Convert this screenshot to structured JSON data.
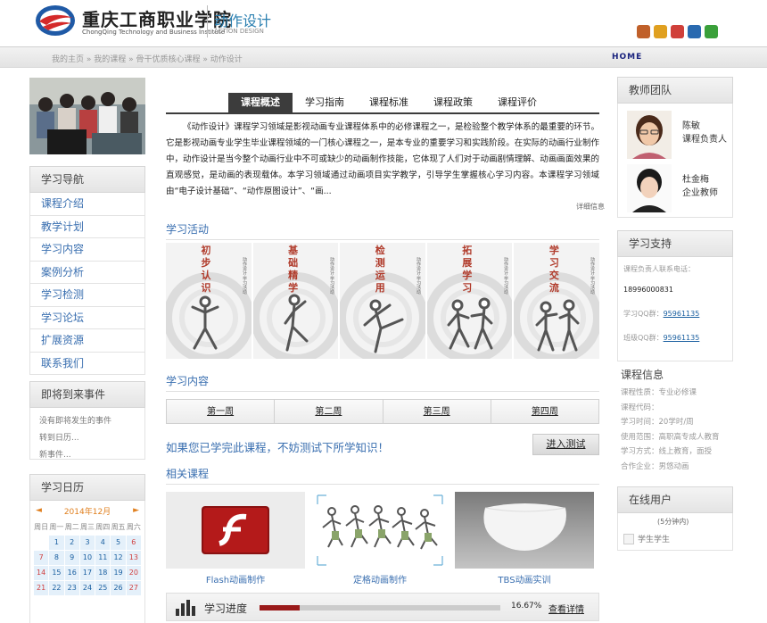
{
  "header": {
    "school_cn": "重庆工商职业学院",
    "school_en": "ChongQing Technology and Business Institute",
    "course_cn": "动作设计",
    "course_en": "ACTION DESIGN"
  },
  "breadcrumb": {
    "items": [
      "我的主页",
      "我的课程",
      "骨干优质核心课程",
      "动作设计"
    ],
    "home_label": "HOME"
  },
  "nav": {
    "title": "学习导航",
    "items": [
      "课程介绍",
      "教学计划",
      "学习内容",
      "案例分析",
      "学习检测",
      "学习论坛",
      "扩展资源",
      "联系我们"
    ]
  },
  "events": {
    "title": "即将到来事件",
    "lines": [
      "没有即将发生的事件",
      "转到日历...",
      "新事件..."
    ]
  },
  "calendar": {
    "title": "学习日历",
    "month": "2014年12月",
    "weekdays": [
      "周日",
      "周一",
      "周二",
      "周三",
      "周四",
      "周五",
      "周六"
    ],
    "rows": [
      [
        "",
        "1",
        "2",
        "3",
        "4",
        "5",
        "6"
      ],
      [
        "7",
        "8",
        "9",
        "10",
        "11",
        "12",
        "13"
      ],
      [
        "14",
        "15",
        "16",
        "17",
        "18",
        "19",
        "20"
      ],
      [
        "21",
        "22",
        "23",
        "24",
        "25",
        "26",
        "27"
      ]
    ]
  },
  "tabs": [
    "课程概述",
    "学习指南",
    "课程标准",
    "课程政策",
    "课程评价"
  ],
  "intro": {
    "text": "《动作设计》课程学习领域是影视动画专业课程体系中的必修课程之一，是检验整个教学体系的最重要的环节。它是影视动画专业学生毕业课程领域的一门核心课程之一，是本专业的重要学习和实践阶段。在实际的动画行业制作中，动作设计是当今整个动画行业中不可或缺少的动画制作技能，它体现了人们对于动画剧情理解、动画画面效果的直观感觉，是动画的表现载体。本学习领域通过动画项目实学教学，引导学生掌握核心学习内容。本课程学习领域由“电子设计基础”、“动作原图设计”、“画...",
    "more": "详细信息"
  },
  "activities": {
    "title": "学习活动",
    "items": [
      {
        "title": "初步认识",
        "side": "动作设计·学习活动"
      },
      {
        "title": "基础精学",
        "side": "动作设计·学习活动"
      },
      {
        "title": "检测运用",
        "side": "动作设计·学习活动"
      },
      {
        "title": "拓展学习",
        "side": "动作设计·学习活动"
      },
      {
        "title": "学习交流",
        "side": "动作设计·学习活动"
      }
    ]
  },
  "content": {
    "title": "学习内容",
    "weeks": [
      "第一周",
      "第二周",
      "第三周",
      "第四周"
    ]
  },
  "test": {
    "question": "如果您已学完此课程，不妨测试下所学知识！",
    "button": "进入测试"
  },
  "related": {
    "title": "相关课程",
    "items": [
      "Flash动画制作",
      "定格动画制作",
      "TBS动画实训"
    ]
  },
  "progress": {
    "label": "学习进度",
    "percent_text": "16.67%",
    "value": 0.1667,
    "link": "查看详情"
  },
  "team": {
    "title": "教师团队",
    "members": [
      {
        "name": "陈敏",
        "role": "课程负责人"
      },
      {
        "name": "杜金梅",
        "role": "企业教师"
      }
    ]
  },
  "support": {
    "title": "学习支持",
    "contact_label": "课程负责人联系电话：",
    "phone": "18996000831",
    "qq1_label": "学习QQ群：",
    "qq1": "95961135",
    "qq2_label": "班级QQ群：",
    "qq2": "95961135"
  },
  "info": {
    "title": "课程信息",
    "lines": [
      "课程性质：专业必修课",
      "课程代码：",
      "学习时间：20学时/周",
      "使用范围：高职高专成人教育",
      "学习方式：线上教育，面授",
      "合作企业：男悠动画"
    ]
  },
  "online": {
    "title": "在线用户",
    "count": "(5分钟内)",
    "user": "学生学生"
  },
  "colors": {
    "link_blue": "#3a6fb0",
    "tab_dark": "#3c3c3c",
    "activity_red": "#b03a2a",
    "progress_fill": "#9a1a1a"
  }
}
